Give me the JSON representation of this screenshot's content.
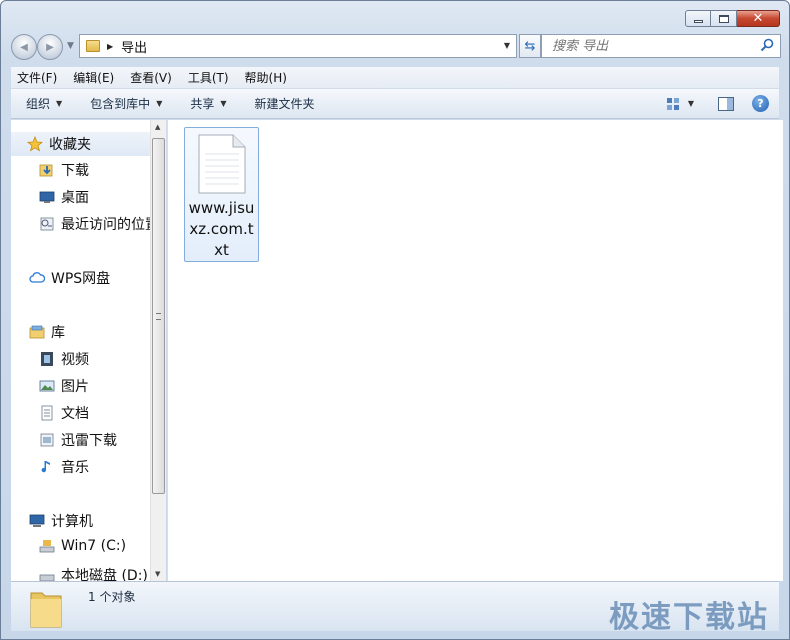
{
  "window": {
    "caption_buttons": {
      "minimize_icon": "minimize-icon",
      "maximize_icon": "maximize-icon",
      "close_glyph": "✕"
    }
  },
  "address_bar": {
    "back_glyph": "◀",
    "forward_glyph": "▶",
    "current_folder": "导出",
    "crumb_separator": "▶"
  },
  "search": {
    "placeholder": "搜索 导出"
  },
  "menu": [
    "文件(F)",
    "编辑(E)",
    "查看(V)",
    "工具(T)",
    "帮助(H)"
  ],
  "commands": {
    "organize": "组织",
    "include_in_library": "包含到库中",
    "share": "共享",
    "new_folder": "新建文件夹",
    "help_glyph": "?"
  },
  "nav_pane": {
    "favorites": "收藏夹",
    "favorites_items": [
      "下载",
      "桌面",
      "最近访问的位置"
    ],
    "wps": "WPS网盘",
    "libraries": "库",
    "libraries_items": [
      "视频",
      "图片",
      "文档",
      "迅雷下载",
      "音乐"
    ],
    "computer": "计算机",
    "computer_items": [
      "Win7 (C:)",
      "本地磁盘 (D:)"
    ]
  },
  "files": [
    {
      "name": "www.jisuxz.com.txt",
      "icon": "text-file-icon"
    }
  ],
  "status": {
    "count_text": "1 个对象",
    "watermark": "极速下载站"
  },
  "colors": {
    "accent": "#2b68b5",
    "selection_border": "#84acdd",
    "chrome": "#cfdcec"
  }
}
